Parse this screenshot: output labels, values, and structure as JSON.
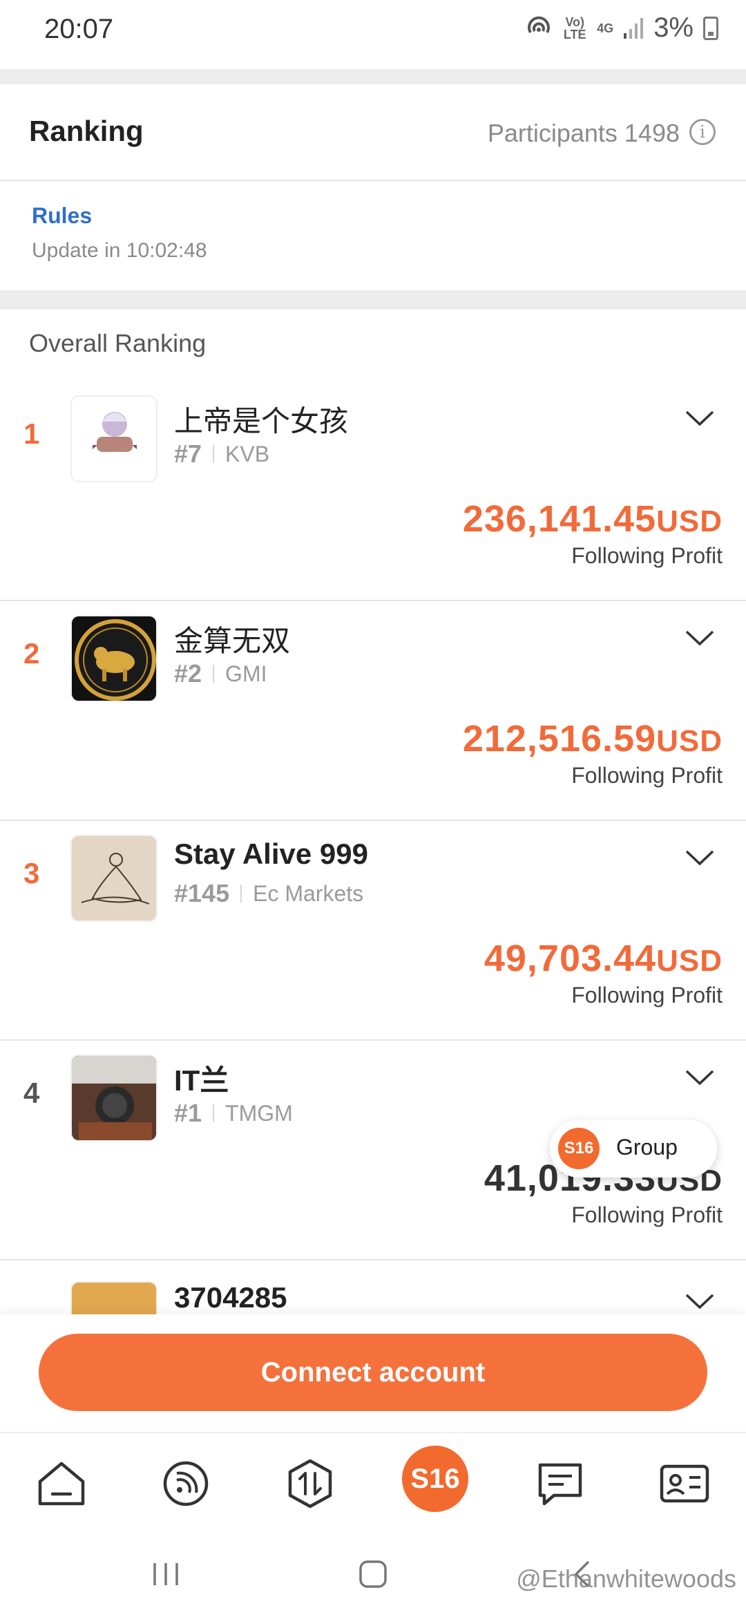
{
  "status": {
    "time": "20:07",
    "volte": "Vo) LTE",
    "network": "4G",
    "battery": "3%"
  },
  "header": {
    "title": "Ranking",
    "participants": "Participants 1498",
    "info_icon": "info-icon"
  },
  "rules": {
    "link": "Rules",
    "update": "Update in 10:02:48"
  },
  "section_title": "Overall Ranking",
  "rankings": [
    {
      "rank": "1",
      "name": "上帝是个女孩",
      "tag": "#7",
      "broker": "KVB",
      "profit": "236,141.45",
      "currency": "USD",
      "profit_label": "Following Profit",
      "color": "#f26a3a"
    },
    {
      "rank": "2",
      "name": "金算无双",
      "tag": "#2",
      "broker": "GMI",
      "profit": "212,516.59",
      "currency": "USD",
      "profit_label": "Following Profit",
      "color": "#f26a3a"
    },
    {
      "rank": "3",
      "name": "Stay Alive 999",
      "tag": "#145",
      "broker": "Ec Markets",
      "profit": "49,703.44",
      "currency": "USD",
      "profit_label": "Following Profit",
      "color": "#f26a3a"
    },
    {
      "rank": "4",
      "name": "IT兰",
      "tag": "#1",
      "broker": "TMGM",
      "profit": "41,019.33",
      "currency": "USD",
      "profit_label": "Following Profit",
      "color": "#333333"
    },
    {
      "rank": "",
      "name": "3704285"
    }
  ],
  "group_pill": {
    "logo": "S16",
    "label": "Group"
  },
  "connect_button": "Connect account",
  "tabbar": {
    "center_logo": "S16",
    "icons": [
      "home-icon",
      "feed-icon",
      "trade-icon",
      "s16-logo",
      "messages-icon",
      "profile-card-icon"
    ]
  },
  "watermark": "@Ethanwhitewoods"
}
